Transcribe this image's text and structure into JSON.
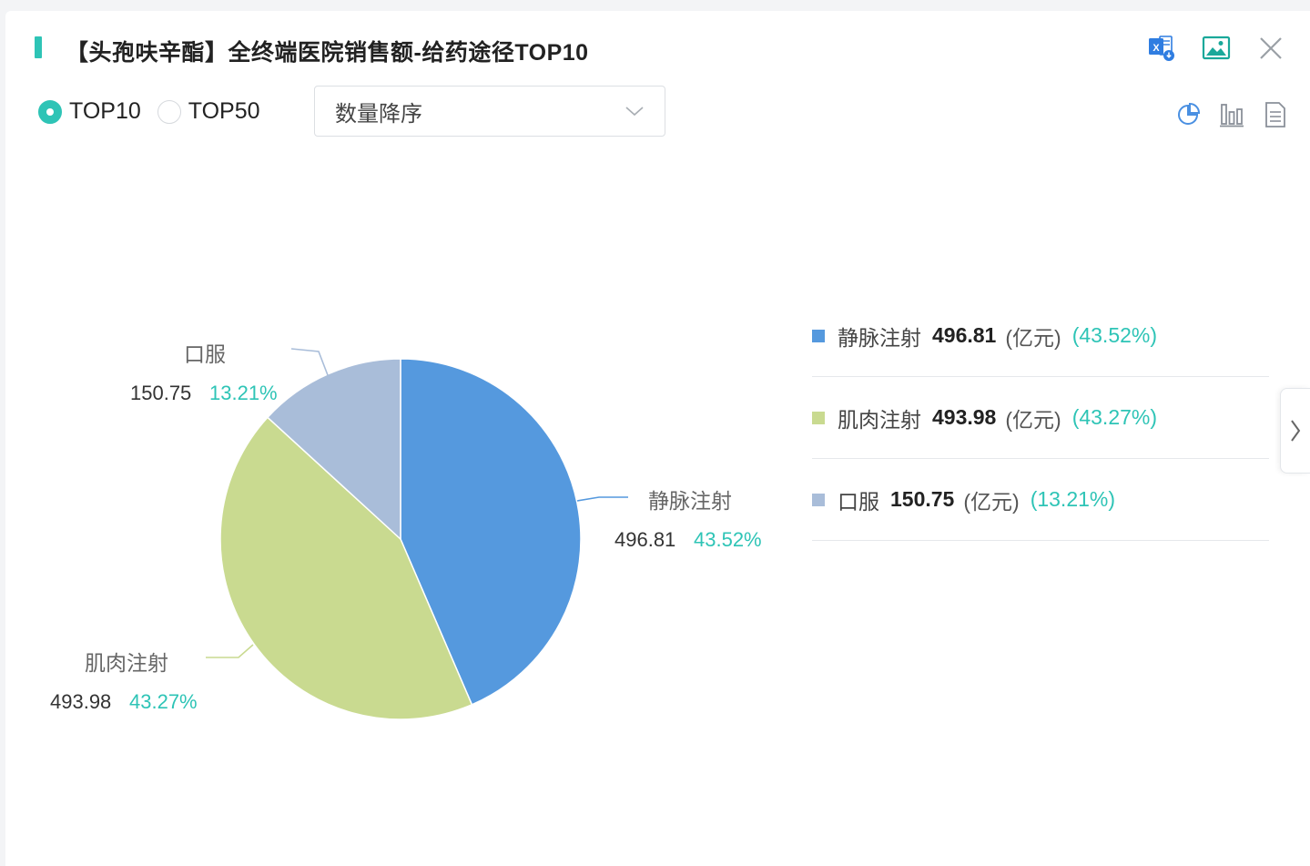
{
  "header": {
    "title": "【头孢呋辛酯】全终端医院销售额-给药途径TOP10"
  },
  "toolbar": {
    "export_excel_icon": "excel-export-icon",
    "export_image_icon": "image-export-icon",
    "close_icon": "close-icon",
    "pie_view_icon": "pie-chart-icon",
    "bar_view_icon": "bar-chart-icon",
    "table_view_icon": "document-icon"
  },
  "filters": {
    "radio_options": [
      {
        "label": "TOP10",
        "checked": true
      },
      {
        "label": "TOP50",
        "checked": false
      }
    ],
    "sort_select": "数量降序"
  },
  "colors": {
    "accent": "#2ec4b6",
    "series": [
      "#5599de",
      "#c9da90",
      "#a9bdd9"
    ]
  },
  "chart_data": {
    "type": "pie",
    "categories": [
      "静脉注射",
      "肌肉注射",
      "口服"
    ],
    "values": [
      496.81,
      493.98,
      150.75
    ],
    "percents": [
      "43.52%",
      "43.27%",
      "13.21%"
    ],
    "value_labels": [
      "496.81",
      "493.98",
      "150.75"
    ],
    "unit": "(亿元)",
    "legend_position": "right",
    "start_angle": "top, clockwise"
  },
  "legend": {
    "items": [
      {
        "name": "静脉注射",
        "value": "496.81",
        "unit": "(亿元)",
        "percent": "(43.52%)"
      },
      {
        "name": "肌肉注射",
        "value": "493.98",
        "unit": "(亿元)",
        "percent": "(43.27%)"
      },
      {
        "name": "口服",
        "value": "150.75",
        "unit": "(亿元)",
        "percent": "(13.21%)"
      }
    ]
  }
}
